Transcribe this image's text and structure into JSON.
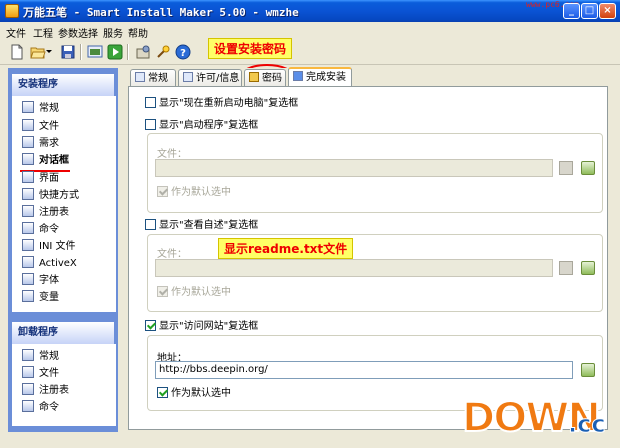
{
  "window": {
    "title": "万能五笔 - Smart Install Maker 5.00 - wmzhe",
    "top_watermark": "www.pc6.com",
    "buttons": {
      "minimize": "_",
      "maximize": "□",
      "close": "×"
    }
  },
  "menu": [
    "文件",
    "工程",
    "参数选择",
    "服务",
    "帮助"
  ],
  "toolbar_icons": [
    "new-file-icon",
    "open-folder-icon",
    "save-icon",
    "build-icon",
    "run-icon",
    "settings-icon",
    "wizard-icon",
    "help-icon"
  ],
  "annotations": {
    "top": "设置安装密码",
    "middle": "显示readme.txt文件"
  },
  "sidebar": {
    "install_title": "安装程序",
    "install_items": [
      "常规",
      "文件",
      "需求",
      "对话框",
      "界面",
      "快捷方式",
      "注册表",
      "命令",
      "INI 文件",
      "ActiveX",
      "字体",
      "变量"
    ],
    "active_item": "对话框",
    "uninstall_title": "卸载程序",
    "uninstall_items": [
      "常规",
      "文件",
      "注册表",
      "命令"
    ]
  },
  "tabs": [
    "常规",
    "许可/信息",
    "密码",
    "完成安装"
  ],
  "active_tab": "完成安装",
  "content": {
    "restart_checkbox": "显示\"现在重新启动电脑\"复选框",
    "launch_checkbox": "显示\"启动程序\"复选框",
    "launch_file_label": "文件：",
    "launch_default": "作为默认选中",
    "readme_checkbox": "显示\"查看自述\"复选框",
    "readme_file_label": "文件：",
    "readme_default": "作为默认选中",
    "visit_checkbox": "显示\"访问网站\"复选框",
    "address_label": "地址：",
    "address_value": "http://bbs.deepin.org/",
    "visit_default": "作为默认选中"
  },
  "logo": {
    "text": "DOWN",
    "suffix": ".cc"
  },
  "colors": {
    "titlebar": "#0a53d4",
    "sidebar": "#6b8ed8",
    "annotation_bg": "#ffff66",
    "annotation_fg": "#e00000",
    "logo_orange": "#f07a12",
    "logo_blue": "#1a5fb4"
  }
}
